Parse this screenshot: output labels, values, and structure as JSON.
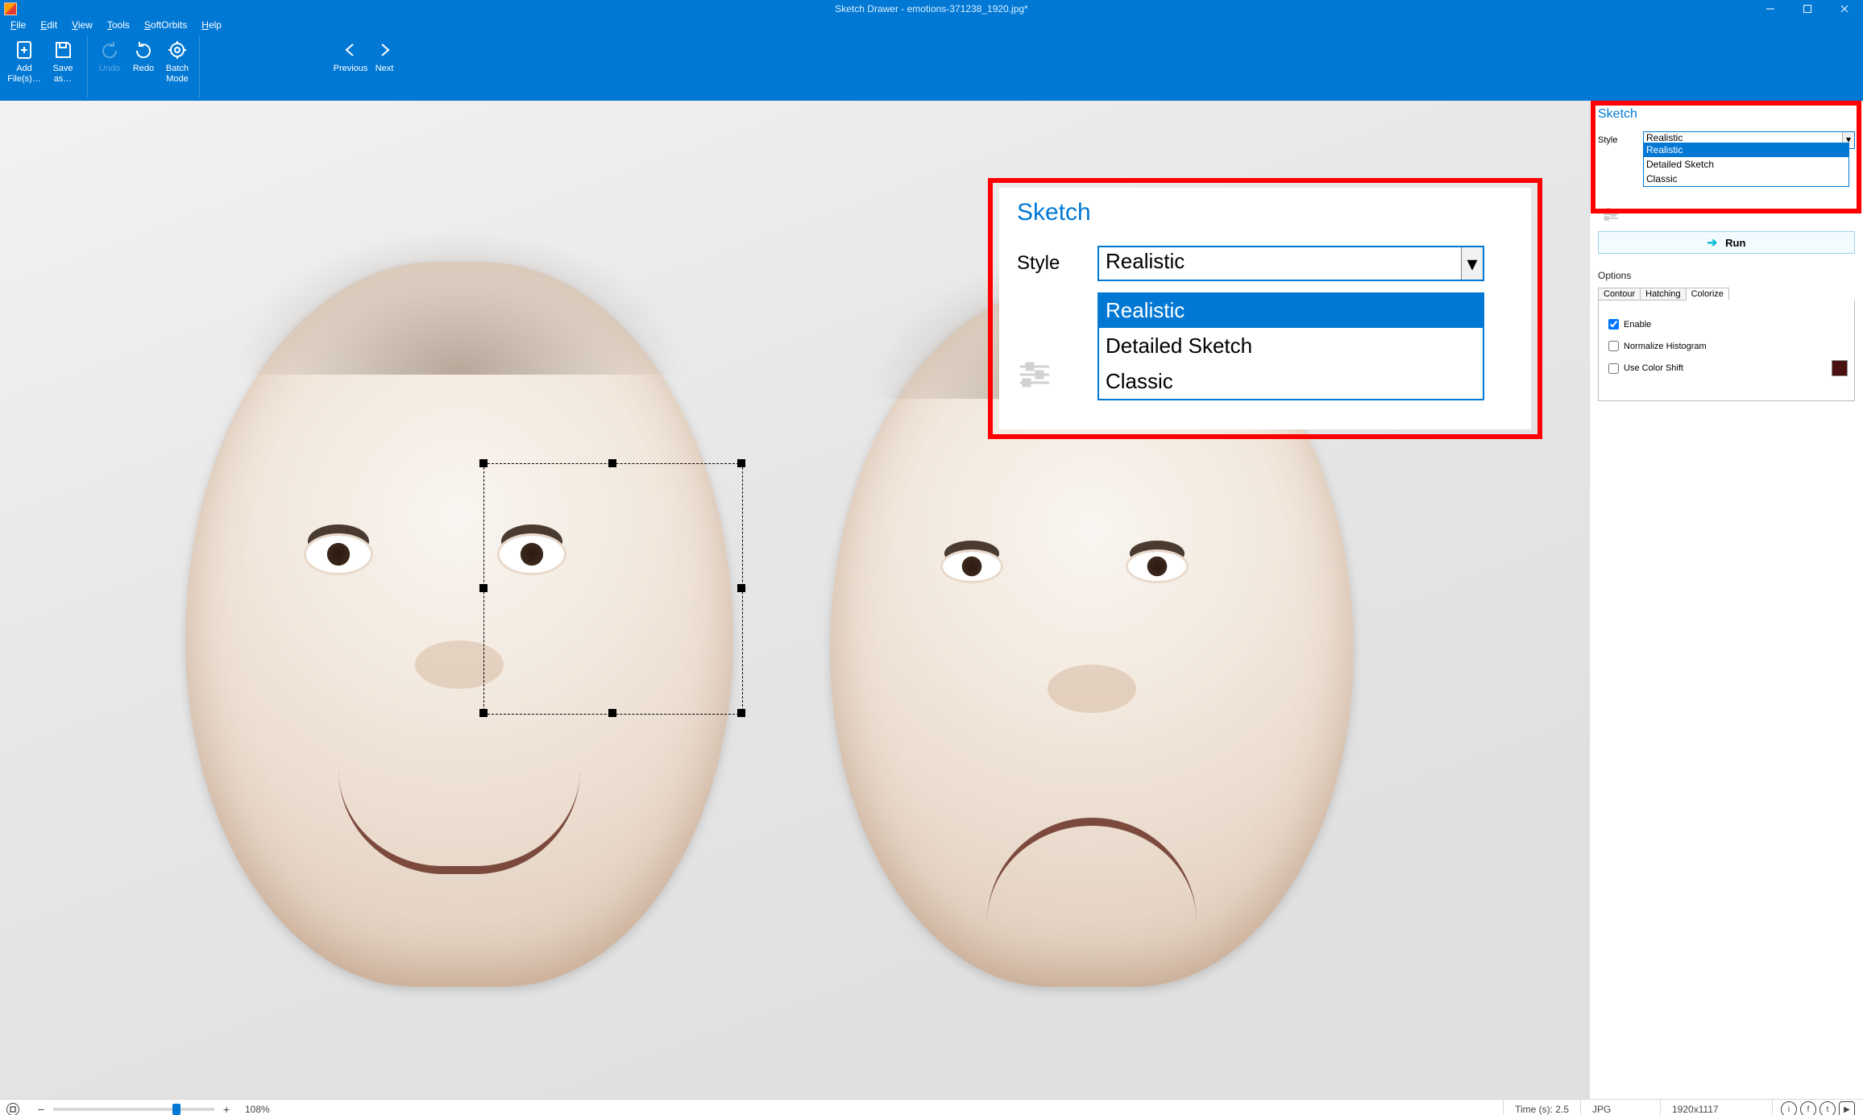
{
  "app": {
    "title": "Sketch Drawer - emotions-371238_1920.jpg*"
  },
  "menu": {
    "items": [
      "File",
      "Edit",
      "View",
      "Tools",
      "SoftOrbits",
      "Help"
    ]
  },
  "ribbon": {
    "add_files": "Add File(s)…",
    "save_as": "Save as…",
    "undo": "Undo",
    "redo": "Redo",
    "batch": "Batch Mode",
    "prev": "Previous",
    "next": "Next"
  },
  "sidepanel": {
    "title": "Sketch",
    "style_label": "Style",
    "style_value": "Realistic",
    "style_options": [
      "Realistic",
      "Detailed Sketch",
      "Classic"
    ],
    "run": "Run",
    "options_title": "Options",
    "tabs": [
      "Contour",
      "Hatching",
      "Colorize"
    ],
    "active_tab": "Colorize",
    "enable": "Enable",
    "normalize": "Normalize Histogram",
    "use_color_shift": "Use Color Shift",
    "color_shift_swatch": "#4a1110"
  },
  "zoom_inset": {
    "title": "Sketch",
    "style_label": "Style",
    "style_value": "Realistic",
    "options": [
      "Realistic",
      "Detailed Sketch",
      "Classic"
    ]
  },
  "status": {
    "zoom_pct": "108%",
    "time_label": "Time (s): 2.5",
    "fmt": "JPG",
    "dims": "1920x1117"
  },
  "colors": {
    "accent": "#0078D4",
    "highlight": "#ff0000"
  }
}
